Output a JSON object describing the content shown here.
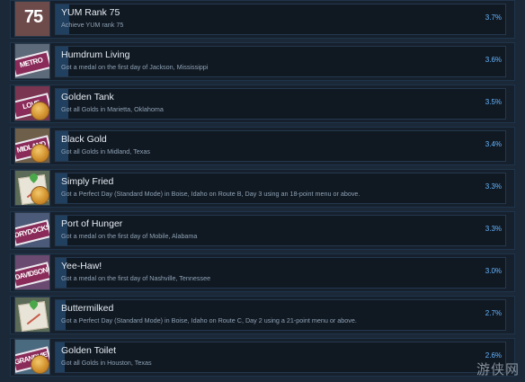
{
  "achievements": [
    {
      "title": "YUM Rank 75",
      "description": "Achieve YUM rank 75",
      "percent": "3.7%",
      "fill": 0.037,
      "icon": "rank-75-icon",
      "icon_text": "75",
      "icon_bg": "#6e4b4b"
    },
    {
      "title": "Humdrum Living",
      "description": "Got a medal on the first day of Jackson, Mississippi",
      "percent": "3.6%",
      "fill": 0.036,
      "icon": "jackson-plate-icon",
      "icon_text": "METRO CENTRAL",
      "icon_bg": "#5d6a7a"
    },
    {
      "title": "Golden Tank",
      "description": "Got all Golds in Marietta, Oklahoma",
      "percent": "3.5%",
      "fill": 0.035,
      "icon": "marietta-plate-medal-icon",
      "icon_text": "LOVE COUNTY",
      "icon_bg": "#7a3550"
    },
    {
      "title": "Black Gold",
      "description": "Got all Golds in Midland, Texas",
      "percent": "3.4%",
      "fill": 0.034,
      "icon": "midland-plate-medal-icon",
      "icon_text": "MIDLAND",
      "icon_bg": "#6e5f4a"
    },
    {
      "title": "Simply Fried",
      "description": "Got a Perfect Day (Standard Mode) in Boise, Idaho on Route B, Day 3 using an 18-point menu or above.",
      "percent": "3.3%",
      "fill": 0.033,
      "icon": "boise-map-medal-icon",
      "icon_text": "",
      "icon_bg": "#5c6b57"
    },
    {
      "title": "Port of Hunger",
      "description": "Got a medal on the first day of Mobile, Alabama",
      "percent": "3.3%",
      "fill": 0.033,
      "icon": "mobile-plate-icon",
      "icon_text": "DRYDOCKS",
      "icon_bg": "#4a5a78"
    },
    {
      "title": "Yee-Haw!",
      "description": "Got a medal on the first day of Nashville, Tennessee",
      "percent": "3.0%",
      "fill": 0.03,
      "icon": "nashville-plate-icon",
      "icon_text": "DAVIDSON COUNTY",
      "icon_bg": "#6a4a70"
    },
    {
      "title": "Buttermilked",
      "description": "Got a Perfect Day (Standard Mode) in Boise, Idaho on Route C, Day 2 using a 21-point menu or above.",
      "percent": "2.7%",
      "fill": 0.027,
      "icon": "boise-map-icon",
      "icon_text": "",
      "icon_bg": "#5c6b57"
    },
    {
      "title": "Golden Toilet",
      "description": "Got all Golds in Houston, Texas",
      "percent": "2.6%",
      "fill": 0.026,
      "icon": "houston-plate-medal-icon",
      "icon_text": "GRANDVIEW",
      "icon_bg": "#4a6a80"
    }
  ],
  "watermark": "游侠网"
}
